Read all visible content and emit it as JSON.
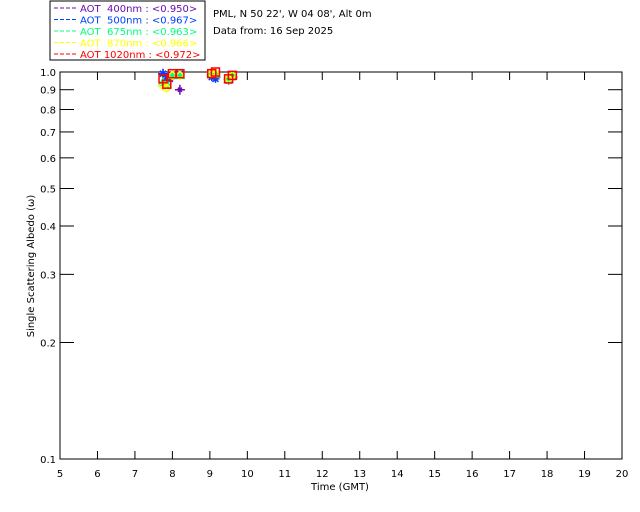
{
  "header": {
    "site": "PML, N 50 22', W 04 08', Alt 0m",
    "date": "Data from: 16 Sep 2025"
  },
  "chart_data": {
    "type": "scatter",
    "xlabel": "Time (GMT)",
    "ylabel": "Single Scattering Albedo (ω)",
    "xlim": [
      5,
      20
    ],
    "ylim": [
      0.1,
      1.0
    ],
    "yscale": "log",
    "xticks": [
      "5",
      "6",
      "7",
      "8",
      "9",
      "10",
      "11",
      "12",
      "13",
      "14",
      "15",
      "16",
      "17",
      "18",
      "19",
      "20"
    ],
    "yticks": [
      {
        "v": 1.0,
        "label": "1.0"
      },
      {
        "v": 0.9,
        "label": "0.9"
      },
      {
        "v": 0.8,
        "label": "0.8"
      },
      {
        "v": 0.7,
        "label": "0.7"
      },
      {
        "v": 0.6,
        "label": "0.6"
      },
      {
        "v": 0.5,
        "label": "0.5"
      },
      {
        "v": 0.4,
        "label": "0.4"
      },
      {
        "v": 0.3,
        "label": "0.3"
      },
      {
        "v": 0.2,
        "label": "0.2"
      },
      {
        "v": 0.1,
        "label": "0.1"
      }
    ],
    "grid": false,
    "legend_position": "top-left outside",
    "series": [
      {
        "name": "AOT  400nm : <0.950>",
        "color": "#6a0dad",
        "marker": "star",
        "x": [
          7.75,
          7.85,
          8.0,
          8.2,
          9.05,
          9.15,
          9.5,
          9.6
        ],
        "y": [
          0.99,
          0.95,
          0.97,
          0.9,
          0.98,
          0.97,
          0.96,
          0.97
        ]
      },
      {
        "name": "AOT  500nm : <0.967>",
        "color": "#0040ff",
        "marker": "asterisk",
        "x": [
          7.75,
          7.85,
          8.0,
          8.2,
          9.05,
          9.15,
          9.5,
          9.6
        ],
        "y": [
          0.99,
          0.96,
          0.98,
          0.99,
          0.97,
          0.96,
          0.95,
          0.97
        ]
      },
      {
        "name": "AOT  675nm : <0.963>",
        "color": "#00ff80",
        "marker": "triangle",
        "x": [
          7.75,
          7.85,
          8.0,
          8.2,
          9.05,
          9.15,
          9.5,
          9.6
        ],
        "y": [
          0.94,
          0.93,
          0.98,
          0.98,
          0.99,
          0.99,
          0.96,
          0.98
        ]
      },
      {
        "name": "AOT  870nm : <0.966>",
        "color": "#ffff00",
        "marker": "diamond",
        "x": [
          7.75,
          7.85,
          8.0,
          8.2,
          9.05,
          9.15,
          9.5,
          9.6
        ],
        "y": [
          0.92,
          0.91,
          0.98,
          0.98,
          0.99,
          0.99,
          0.96,
          0.98
        ]
      },
      {
        "name": "AOT 1020nm : <0.972>",
        "color": "#ff0000",
        "marker": "square",
        "x": [
          7.75,
          7.85,
          8.0,
          8.2,
          9.05,
          9.15,
          9.5,
          9.6
        ],
        "y": [
          0.96,
          0.93,
          0.99,
          0.99,
          0.99,
          1.0,
          0.96,
          0.98
        ]
      }
    ]
  }
}
